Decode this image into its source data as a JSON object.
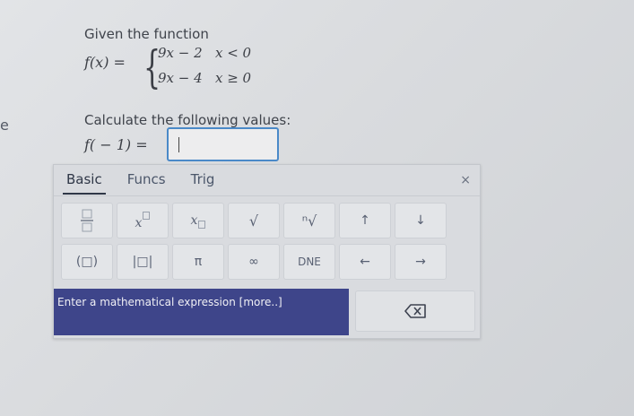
{
  "side_letter": "e",
  "problem": {
    "intro": "Given the function",
    "function_lhs": "f(x) =",
    "cases": [
      {
        "expr": "9x − 2",
        "condition": "x < 0"
      },
      {
        "expr": "9x − 4",
        "condition": "x ≥ 0"
      }
    ],
    "instruction": "Calculate the following values:",
    "query": "f( − 1) =",
    "answer_value": ""
  },
  "keypad": {
    "tabs": [
      "Basic",
      "Funcs",
      "Trig"
    ],
    "active_tab": "Basic",
    "close_label": "×",
    "row1": [
      "fraction",
      "x²",
      "x₀",
      "√",
      "ⁿ√",
      "↑",
      "↓"
    ],
    "row2": [
      "(□)",
      "|□|",
      "π",
      "∞",
      "DNE",
      "←",
      "→"
    ],
    "hint": "Enter a mathematical expression [more..]",
    "backspace_icon": "backspace-icon"
  }
}
